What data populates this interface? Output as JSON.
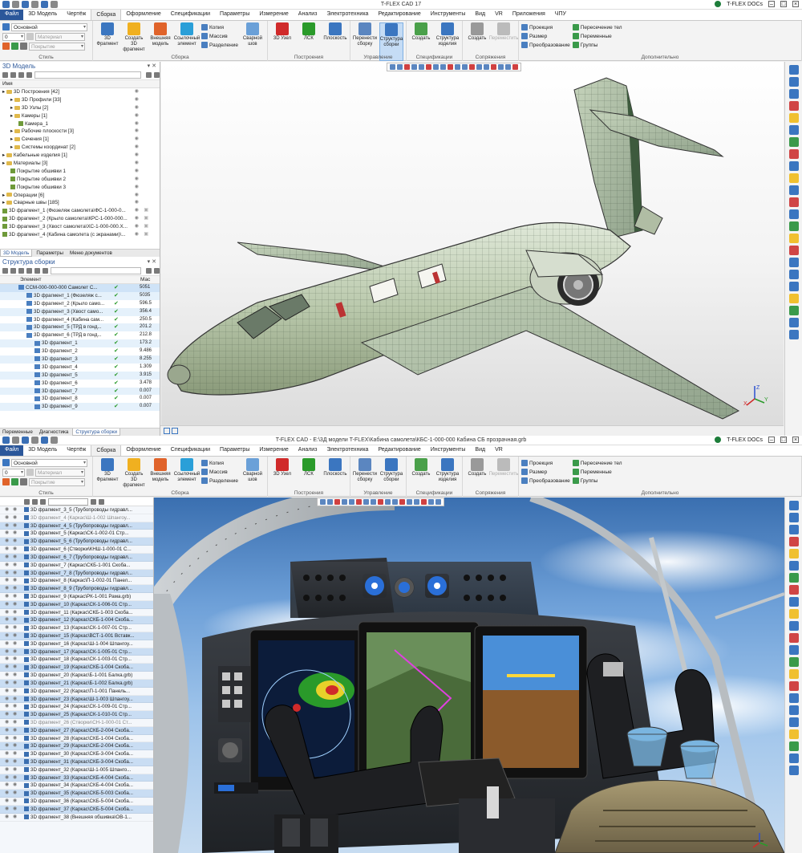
{
  "window1": {
    "title": "T-FLEX CAD 17",
    "docs_label": "T-FLEX DOCs",
    "menu": [
      "Файл",
      "3D Модель",
      "Чертёж",
      "Сборка",
      "Оформление",
      "Спецификации",
      "Параметры",
      "Измерение",
      "Анализ",
      "Электротехника",
      "Редактирование",
      "Инструменты",
      "Вид",
      "VR",
      "Приложения",
      "ЧПУ"
    ],
    "active_menu": "Сборка"
  },
  "window2": {
    "title": "T-FLEX CAD - E:\\3Д модели T-FLEX\\Кабина самолета\\КБС-1-000-000 Кабина СБ прозрачная.grb",
    "docs_label": "T-FLEX DOCs",
    "menu": [
      "Файл",
      "3D Модель",
      "Чертёж",
      "Сборка",
      "Оформление",
      "Спецификации",
      "Параметры",
      "Измерение",
      "Анализ",
      "Электротехника",
      "Редактирование",
      "Инструменты",
      "Вид",
      "VR"
    ]
  },
  "ribbon": {
    "style": {
      "layer": "Основной",
      "level": "0",
      "material": "Материал",
      "coating": "Покрытие",
      "label": "Стиль"
    },
    "assembly": {
      "label": "Сборка",
      "buttons": [
        "3D Фрагмент",
        "Создать 3D фрагмент",
        "Внешняя модель",
        "Ссылочный элемент"
      ],
      "small": [
        "Копия",
        "Массив",
        "Разделение"
      ],
      "weld": "Сварной шов"
    },
    "build": {
      "label": "Построения",
      "buttons": [
        "3D Узел",
        "ЛСК",
        "Плоскость"
      ]
    },
    "control": {
      "label": "Управление",
      "buttons": [
        "Перенести сборку",
        "Структура сборки"
      ]
    },
    "specs": {
      "label": "Спецификации",
      "buttons": [
        "Создать",
        "Структура изделия"
      ]
    },
    "mates": {
      "label": "Сопряжения",
      "buttons": [
        "Создать",
        "Переместить"
      ]
    },
    "extra": {
      "label": "Дополнительно",
      "col1": [
        "Проекция",
        "Размер",
        "Преобразование"
      ],
      "col2": [
        "Пересечение тел",
        "Переменные",
        "Группы"
      ],
      "col2_alt": [
        "Пересечение тел",
        "Переменные",
        "Группы"
      ]
    }
  },
  "model_panel": {
    "title": "3D Модель",
    "col": "Имя",
    "items": [
      {
        "t": "3D Построения [42]",
        "lvl": 0,
        "f": 1
      },
      {
        "t": "3D Профили [33]",
        "lvl": 1,
        "f": 1
      },
      {
        "t": "3D Узлы [2]",
        "lvl": 1,
        "f": 1
      },
      {
        "t": "Камеры [1]",
        "lvl": 1,
        "f": 1
      },
      {
        "t": "Камера_1",
        "lvl": 2,
        "f": 0
      },
      {
        "t": "Рабочие плоскости [3]",
        "lvl": 1,
        "f": 1
      },
      {
        "t": "Сечения [1]",
        "lvl": 1,
        "f": 1
      },
      {
        "t": "Системы координат [2]",
        "lvl": 1,
        "f": 1
      },
      {
        "t": "Кабельные изделия [1]",
        "lvl": 0,
        "f": 1
      },
      {
        "t": "Материалы [3]",
        "lvl": 0,
        "f": 1
      },
      {
        "t": "Покрытие обшивки 1",
        "lvl": 1,
        "f": 0
      },
      {
        "t": "Покрытие обшивки 2",
        "lvl": 1,
        "f": 0
      },
      {
        "t": "Покрытие обшивки 3",
        "lvl": 1,
        "f": 0
      },
      {
        "t": "Операции [6]",
        "lvl": 0,
        "f": 1
      },
      {
        "t": "Сварные швы [185]",
        "lvl": 0,
        "f": 1
      },
      {
        "t": "3D фрагмент_1 (Фюзеляж самолета\\ФС-1-000-0...",
        "lvl": 0,
        "f": 0
      },
      {
        "t": "3D фрагмент_2 (Крыло самолета\\КРС-1-000-000...",
        "lvl": 0,
        "f": 0
      },
      {
        "t": "3D фрагмент_3 (Хвост самолета\\ХС-1-000-000.X...",
        "lvl": 0,
        "f": 0
      },
      {
        "t": "3D фрагмент_4 (Кабина самолета (с экранами)\\...",
        "lvl": 0,
        "f": 0
      }
    ],
    "tabs": [
      "3D Модель",
      "Параметры",
      "Меню документов"
    ]
  },
  "assembly_panel": {
    "title": "Структура сборки",
    "col_elem": "Элемент",
    "col_mass": "Мас",
    "rows": [
      {
        "t": "ССМ-000-000-000 Самолет С...",
        "m": "5051",
        "lvl": 0,
        "sel": 1
      },
      {
        "t": "3D фрагмент_1 (Фюзеляж с...",
        "m": "5035",
        "lvl": 1
      },
      {
        "t": "3D фрагмент_2 (Крыло само...",
        "m": "596.5",
        "lvl": 1
      },
      {
        "t": "3D фрагмент_3 (Хвост само...",
        "m": "356.4",
        "lvl": 1
      },
      {
        "t": "3D фрагмент_4 (Кабина сам...",
        "m": "250.5",
        "lvl": 1
      },
      {
        "t": "3D фрагмент_5 (ТРД в гонд...",
        "m": "201.2",
        "lvl": 1
      },
      {
        "t": "3D фрагмент_6 (ТРД в гонд...",
        "m": "212.8",
        "lvl": 1
      },
      {
        "t": "3D фрагмент_1",
        "m": "173.2",
        "lvl": 2
      },
      {
        "t": "3D фрагмент_2",
        "m": "9.486",
        "lvl": 2
      },
      {
        "t": "3D фрагмент_3",
        "m": "8.255",
        "lvl": 2
      },
      {
        "t": "3D фрагмент_4",
        "m": "1.309",
        "lvl": 2
      },
      {
        "t": "3D фрагмент_5",
        "m": "3.915",
        "lvl": 2
      },
      {
        "t": "3D фрагмент_6",
        "m": "3.478",
        "lvl": 2
      },
      {
        "t": "3D фрагмент_7",
        "m": "0.007",
        "lvl": 2
      },
      {
        "t": "3D фрагмент_8",
        "m": "0.007",
        "lvl": 2
      },
      {
        "t": "3D фрагмент_9",
        "m": "0.007",
        "lvl": 2
      }
    ],
    "tabs": [
      "Переменные",
      "Диагностика",
      "Структура сборки"
    ]
  },
  "cockpit_panel": {
    "rows": [
      {
        "t": "3D фрагмент_3_5 (Трубопроводы гидравл...",
        "g": 0,
        "s": 0
      },
      {
        "t": "3D фрагмент_4 (Каркас\\Ш-1-002 Шпангоу...",
        "g": 1,
        "s": 0
      },
      {
        "t": "3D фрагмент_4_5 (Трубопроводы гидравл...",
        "g": 0,
        "s": 1
      },
      {
        "t": "3D фрагмент_5 (Каркас\\СК-1-002-01 Стр...",
        "g": 0,
        "s": 0
      },
      {
        "t": "3D фрагмент_5_6 (Трубопроводы гидравл...",
        "g": 0,
        "s": 1
      },
      {
        "t": "3D фрагмент_6 (Створки\\КНШ-1-000-01 С...",
        "g": 0,
        "s": 0
      },
      {
        "t": "3D фрагмент_6_7 (Трубопроводы гидравл...",
        "g": 0,
        "s": 1
      },
      {
        "t": "3D фрагмент_7 (Каркас\\СКБ-1-001 Скоба...",
        "g": 0,
        "s": 0
      },
      {
        "t": "3D фрагмент_7_8 (Трубопроводы гидравл...",
        "g": 0,
        "s": 1
      },
      {
        "t": "3D фрагмент_8 (Каркас\\П-1-002-01 Панел...",
        "g": 0,
        "s": 0
      },
      {
        "t": "3D фрагмент_8_9 (Трубопроводы гидравл...",
        "g": 0,
        "s": 1
      },
      {
        "t": "3D фрагмент_9 (Каркас\\РК-1-001 Рама.grb)",
        "g": 0,
        "s": 0
      },
      {
        "t": "3D фрагмент_10 (Каркас\\СК-1-006-01 Стр...",
        "g": 0,
        "s": 1
      },
      {
        "t": "3D фрагмент_11 (Каркас\\СКБ-1-003 Скоба...",
        "g": 0,
        "s": 0
      },
      {
        "t": "3D фрагмент_12 (Каркас\\СКБ-1-004 Скоба...",
        "g": 0,
        "s": 1
      },
      {
        "t": "3D фрагмент_13 (Каркас\\СК-1-007-01 Стр...",
        "g": 0,
        "s": 0
      },
      {
        "t": "3D фрагмент_15 (Каркас\\ВСТ-1-001 Вставк...",
        "g": 0,
        "s": 1
      },
      {
        "t": "3D фрагмент_16 (Каркас\\Ш-1-004 Шпангоу...",
        "g": 0,
        "s": 0
      },
      {
        "t": "3D фрагмент_17 (Каркас\\СК-1-005-01 Стр...",
        "g": 0,
        "s": 1
      },
      {
        "t": "3D фрагмент_18 (Каркас\\СК-1-003-01 Стр...",
        "g": 0,
        "s": 0
      },
      {
        "t": "3D фрагмент_19 (Каркас\\СКБ-1-004 Скоба...",
        "g": 0,
        "s": 1
      },
      {
        "t": "3D фрагмент_20 (Каркас\\Б-1-001 Балка.grb)",
        "g": 0,
        "s": 0
      },
      {
        "t": "3D фрагмент_21 (Каркас\\Б-1-002 Балка.grb)",
        "g": 0,
        "s": 1
      },
      {
        "t": "3D фрагмент_22 (Каркас\\П-1-001 Панель...",
        "g": 0,
        "s": 0
      },
      {
        "t": "3D фрагмент_23 (Каркас\\Ш-1-003 Шпангоу...",
        "g": 0,
        "s": 1
      },
      {
        "t": "3D фрагмент_24 (Каркас\\СК-1-009-01 Стр...",
        "g": 0,
        "s": 0
      },
      {
        "t": "3D фрагмент_25 (Каркас\\СК-1-010-01 Стр...",
        "g": 0,
        "s": 1
      },
      {
        "t": "3D фрагмент_26 (Створки\\СН-1-000-01 Ст...",
        "g": 1,
        "s": 0
      },
      {
        "t": "3D фрагмент_27 (Каркас\\СКБ-2-004 Скоба...",
        "g": 0,
        "s": 1
      },
      {
        "t": "3D фрагмент_28 (Каркас\\СКБ-1-004 Скоба...",
        "g": 0,
        "s": 0
      },
      {
        "t": "3D фрагмент_29 (Каркас\\СКБ-2-004 Скоба...",
        "g": 0,
        "s": 1
      },
      {
        "t": "3D фрагмент_30 (Каркас\\СКБ-3-004 Скоба...",
        "g": 0,
        "s": 0
      },
      {
        "t": "3D фрагмент_31 (Каркас\\СКБ-3-004 Скоба...",
        "g": 0,
        "s": 1
      },
      {
        "t": "3D фрагмент_32 (Каркас\\Ш-1-005 Шпанго...",
        "g": 0,
        "s": 0
      },
      {
        "t": "3D фрагмент_33 (Каркас\\СКБ-4-004 Скоба...",
        "g": 0,
        "s": 1
      },
      {
        "t": "3D фрагмент_34 (Каркас\\СКБ-4-004 Скоба...",
        "g": 0,
        "s": 0
      },
      {
        "t": "3D фрагмент_35 (Каркас\\СКБ-5-003 Скоба...",
        "g": 0,
        "s": 1
      },
      {
        "t": "3D фрагмент_36 (Каркас\\СКБ-5-004 Скоба...",
        "g": 0,
        "s": 0
      },
      {
        "t": "3D фрагмент_37 (Каркас\\СКБ-5-004 Скоба...",
        "g": 0,
        "s": 1
      },
      {
        "t": "3D фрагмент_38 (Внешняя обшивка\\ОВ-1...",
        "g": 0,
        "s": 0
      }
    ]
  },
  "colors": {
    "accent": "#2b579a",
    "select": "#cfe3f7",
    "panel_bg": "#f0f0f0"
  }
}
